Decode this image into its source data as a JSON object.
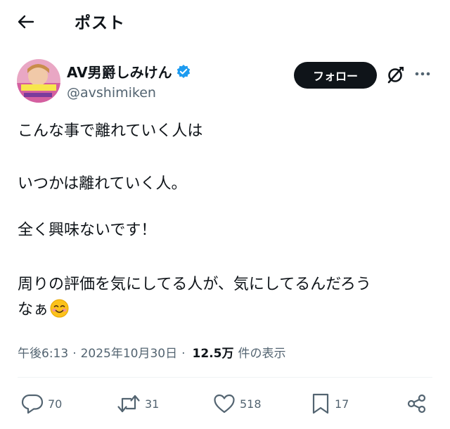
{
  "header": {
    "title": "ポスト"
  },
  "author": {
    "display_name": "AV男爵しみけん",
    "handle": "@avshimiken",
    "follow_label": "フォロー"
  },
  "post": {
    "lines": [
      "こんな事で離れていく人は",
      "いつかは離れていく人。",
      "全く興味ないです！",
      "周りの評価を気にしてる人が、気にしてるんだろう",
      "なぁ"
    ]
  },
  "meta": {
    "time": "午後6:13",
    "sep1": "·",
    "date": "2025年10月30日",
    "sep2": "·",
    "views": "12.5万",
    "views_label": "件の表示"
  },
  "actions": {
    "replies": "70",
    "reposts": "31",
    "likes": "518",
    "bookmarks": "17"
  },
  "colors": {
    "text": "#0f1419",
    "secondary": "#536471",
    "verified": "#1d9bf0"
  },
  "icons": [
    "back-arrow-icon",
    "verified-badge-icon",
    "grok-icon",
    "more-icon",
    "smiling-face-emoji",
    "reply-icon",
    "repost-icon",
    "like-icon",
    "bookmark-icon",
    "share-icon"
  ]
}
